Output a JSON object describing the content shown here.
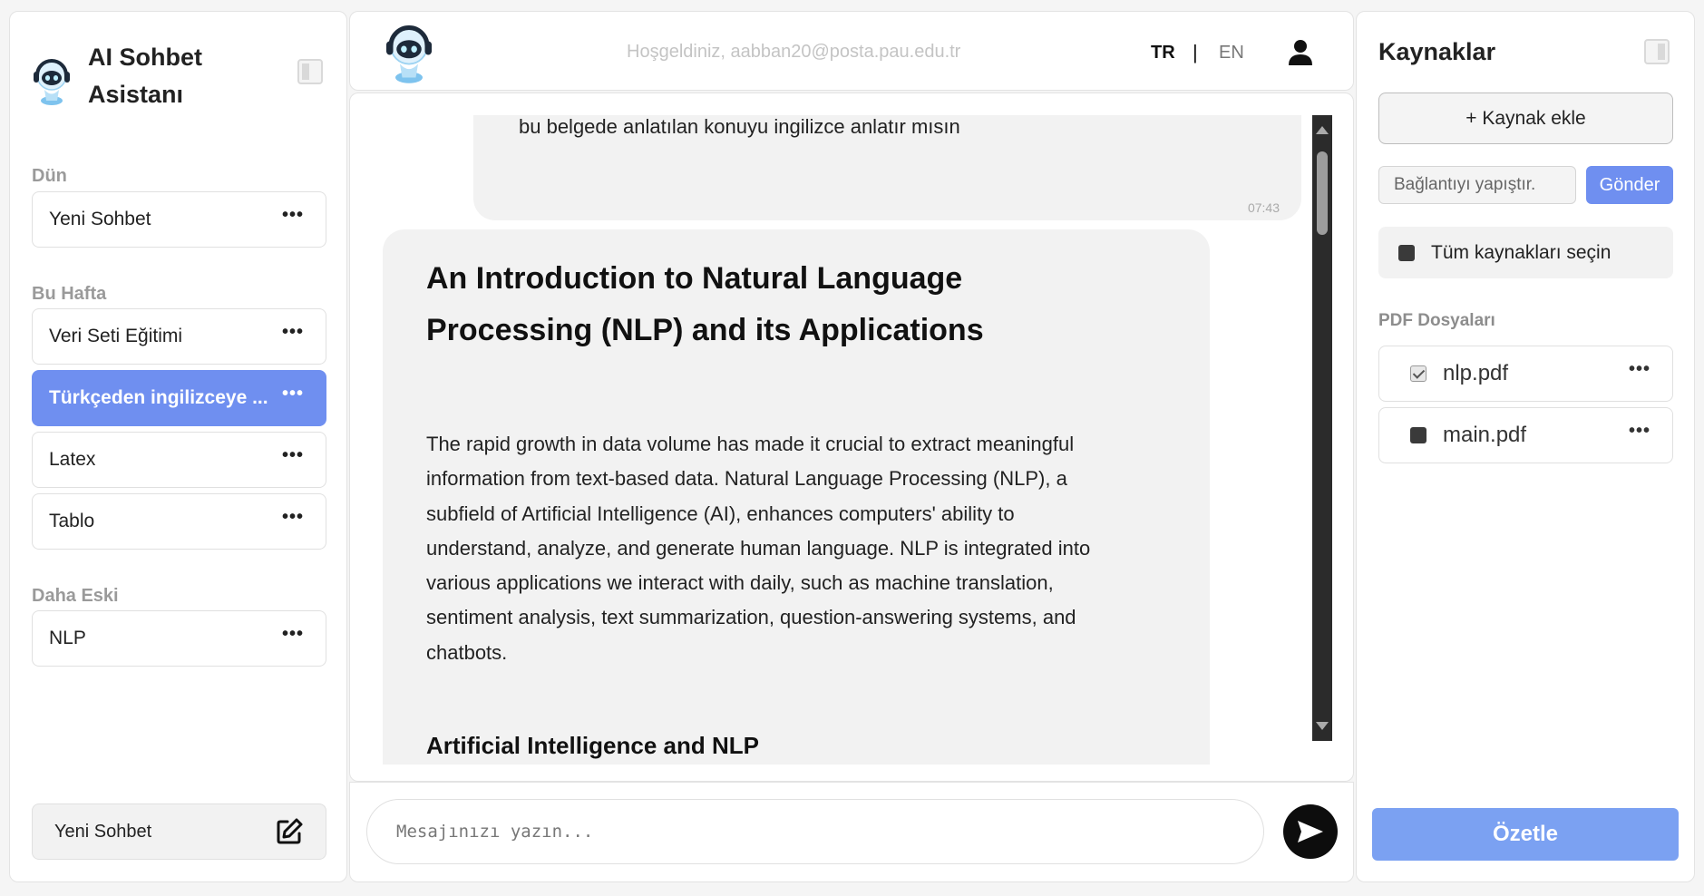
{
  "left_sidebar": {
    "app_title": "AI Sohbet Asistanı",
    "sections": [
      {
        "label": "Dün",
        "items": [
          {
            "label": "Yeni Sohbet",
            "active": false
          }
        ]
      },
      {
        "label": "Bu Hafta",
        "items": [
          {
            "label": "Veri Seti Eğitimi",
            "active": false
          },
          {
            "label": "Türkçeden ingilizceye ...",
            "active": true
          },
          {
            "label": "Latex",
            "active": false
          },
          {
            "label": "Tablo",
            "active": false
          }
        ]
      },
      {
        "label": "Daha Eski",
        "items": [
          {
            "label": "NLP",
            "active": false
          }
        ]
      }
    ],
    "menu_glyph": "•••",
    "new_chat_label": "Yeni Sohbet"
  },
  "header": {
    "welcome": "Hoşgeldiniz, aabban20@posta.pau.edu.tr",
    "lang_tr": "TR",
    "lang_separator": "|",
    "lang_en": "EN",
    "active_language": "TR"
  },
  "chat": {
    "user_message": {
      "text": "bu belgede anlatılan konuyu ingilizce anlatır mısın",
      "time": "07:43"
    },
    "bot_message": {
      "title": "An Introduction to Natural Language Processing (NLP) and its Applications",
      "paragraph": "The rapid growth in data volume has made it crucial to extract meaningful information from text-based data. Natural Language Processing (NLP), a subfield of Artificial Intelligence (AI), enhances computers' ability to understand, analyze, and generate human language. NLP is integrated into various applications we interact with daily, such as machine translation, sentiment analysis, text summarization, question-answering systems, and chatbots.",
      "subheading": "Artificial Intelligence and NLP"
    }
  },
  "input": {
    "placeholder": "Mesajınızı yazın..."
  },
  "right_sidebar": {
    "title": "Kaynaklar",
    "add_source_label": "+ Kaynak ekle",
    "link_placeholder": "Bağlantıyı yapıştır.",
    "send_label": "Gönder",
    "select_all_label": "Tüm kaynakları seçin",
    "pdf_section_label": "PDF Dosyaları",
    "pdf_files": [
      {
        "name": "nlp.pdf",
        "checked": true
      },
      {
        "name": "main.pdf",
        "checked": false
      }
    ],
    "summarize_label": "Özetle"
  },
  "colors": {
    "accent": "#6f8ff0",
    "summarize": "#7ba1f2",
    "scrollbar": "#2b2b2b"
  }
}
